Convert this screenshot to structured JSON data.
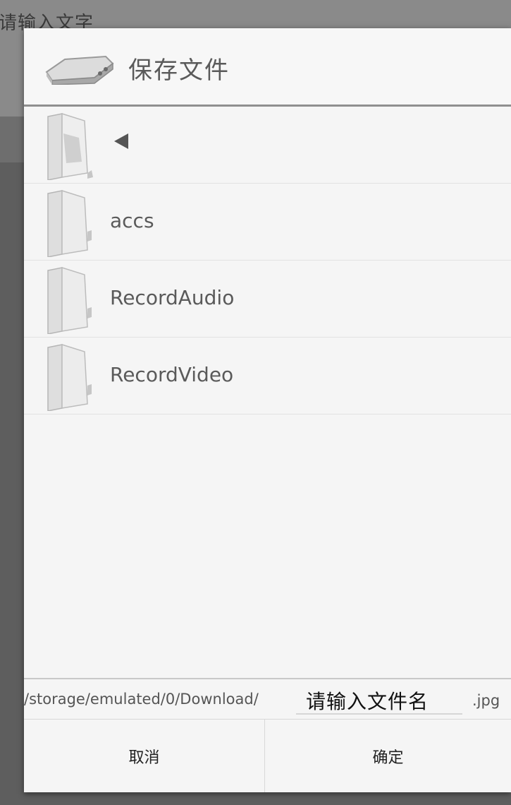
{
  "background": {
    "hint_text": "请输入文字"
  },
  "dialog": {
    "title": "保存文件",
    "items": [
      {
        "label": "",
        "type": "parent"
      },
      {
        "label": "accs",
        "type": "folder"
      },
      {
        "label": "RecordAudio",
        "type": "folder"
      },
      {
        "label": "RecordVideo",
        "type": "folder"
      }
    ],
    "path": "/storage/emulated/0/Download/",
    "filename_placeholder": "请输入文件名",
    "extension": ".jpg",
    "cancel_label": "取消",
    "confirm_label": "确定"
  },
  "icons": [
    "hard-drive-icon",
    "folder-up-icon",
    "back-arrow-icon",
    "folder-icon"
  ]
}
